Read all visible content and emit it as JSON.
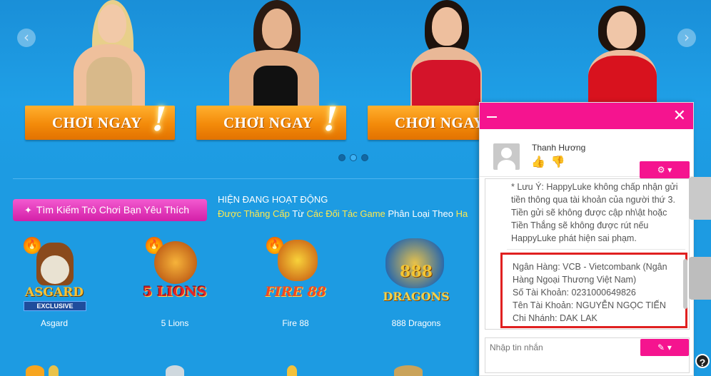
{
  "hero": {
    "play_label": "CHƠI NGAY",
    "bang": "!",
    "prev_icon": "‹",
    "next_icon": "›"
  },
  "filter": {
    "search_button": "Tìm Kiếm Trò Chơi Bạn Yêu Thích",
    "active_title": "HIỆN ĐANG HOẠT ĐỘNG",
    "active_sub_1": "Được Thăng Cấp",
    "active_sub_2": " Từ ",
    "active_sub_3": "Các Đối Tác Game",
    "active_sub_4": " Phân Loại Theo ",
    "active_sub_5": "Ha"
  },
  "games": [
    {
      "name": "Asgard",
      "logo": "ASGARD",
      "badge": "EXCLUSIVE"
    },
    {
      "name": "5 Lions",
      "logo": "5 LIONS"
    },
    {
      "name": "Fire 88",
      "logo": "FIRE 88"
    },
    {
      "name": "888 Dragons",
      "logo": "888 DRAGONS"
    }
  ],
  "chat": {
    "agent_name": "Thanh Hương",
    "gear_icon": "⚙ ▾",
    "message_1": "* Lưu Ý: HappyLuke không chấp nhận gửi tiền thông qua tài khoản của người thứ 3. Tiền gửi sẽ không được cập nh\\ật hoặc Tiền Thắng sẽ không được rút nếu HappyLuke phát hiện sai phạm.",
    "bank_line": "Ngân Hàng: VCB - Vietcombank (Ngân Hàng Ngoại Thương Việt Nam)",
    "account_no": "Số Tài Khoản: 0231000649826",
    "account_name": "Tên Tài Khoản: NGUYỄN NGỌC TIẾN",
    "branch": "Chi Nhánh: DAK LAK",
    "input_placeholder": "Nhập tin nhắn",
    "pen_icon": "✎ ▾",
    "close_icon": "✕"
  },
  "help": "?",
  "colors": {
    "accent": "#f5148f",
    "background": "#1d9be2",
    "button_orange": "#f38a0a",
    "highlight_red": "#e02020"
  }
}
